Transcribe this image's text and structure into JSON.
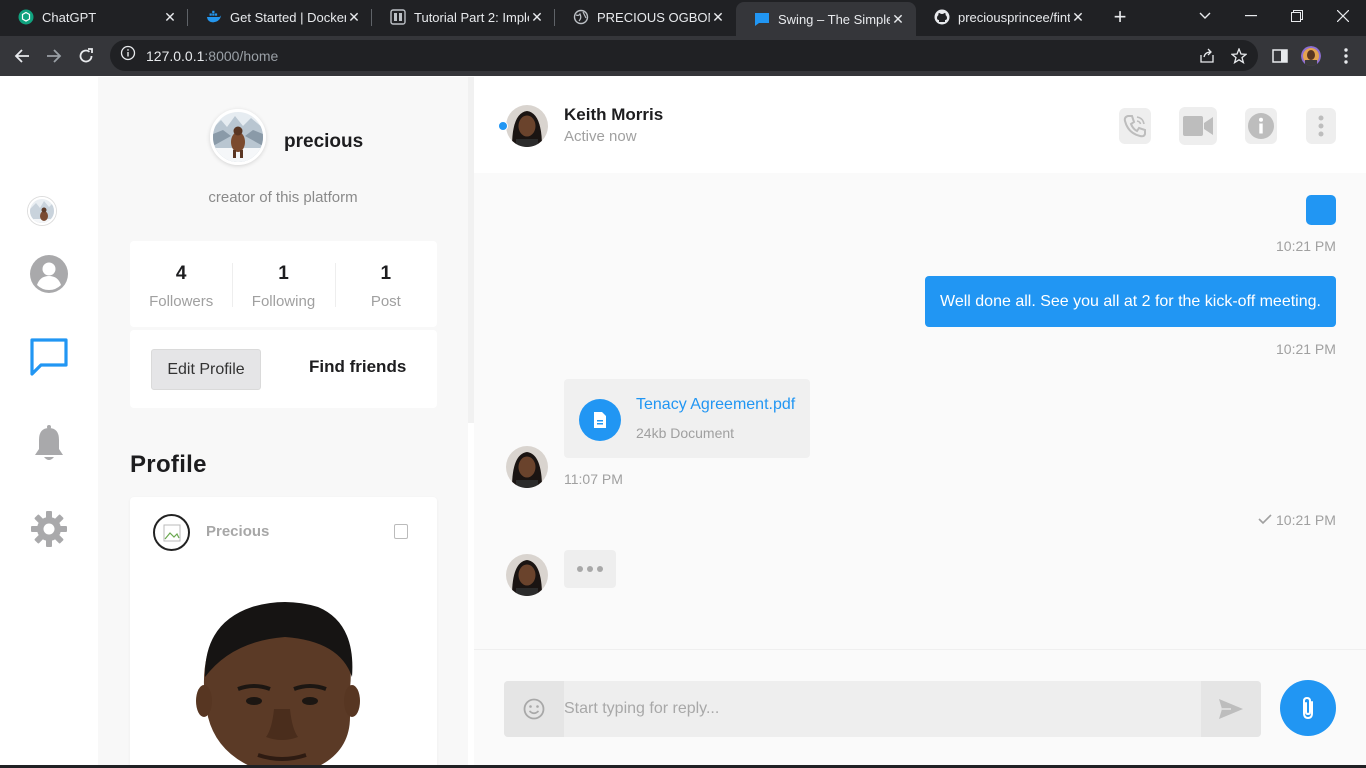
{
  "browser": {
    "tabs": [
      {
        "title": "ChatGPT",
        "icon": "chatgpt-icon"
      },
      {
        "title": "Get Started | Docker",
        "icon": "docker-icon"
      },
      {
        "title": "Tutorial Part 2: Impler",
        "icon": "docs-icon"
      },
      {
        "title": "PRECIOUS OGBONNA",
        "icon": "globe-icon"
      },
      {
        "title": "Swing – The Simplest",
        "icon": "swing-chat-icon"
      },
      {
        "title": "preciousprincee/finte",
        "icon": "github-icon"
      }
    ],
    "active_tab": 4,
    "url_host": "127.0.0.1",
    "url_rest": ":8000/home"
  },
  "profile": {
    "name": "precious",
    "bio": "creator of this platform",
    "stats": [
      {
        "value": "4",
        "label": "Followers"
      },
      {
        "value": "1",
        "label": "Following"
      },
      {
        "value": "1",
        "label": "Post"
      }
    ],
    "edit_label": "Edit Profile",
    "find_label": "Find friends",
    "section_title": "Profile",
    "post_author": "Precious"
  },
  "chat": {
    "contact_name": "Keith Morris",
    "contact_status": "Active now",
    "messages": [
      {
        "time": "10:21 PM"
      },
      {
        "text": "Well done all. See you all at 2 for the kick-off meeting.",
        "time": "10:21 PM"
      },
      {
        "file_name": "Tenacy Agreement.pdf",
        "file_meta": "24kb Document",
        "time": "11:07 PM"
      },
      {
        "time": "10:21 PM",
        "read": true
      }
    ],
    "placeholder": "Start typing for reply..."
  },
  "colors": {
    "accent": "#2196f3",
    "chrome_dark": "#202124",
    "chrome_mid": "#35363a"
  }
}
